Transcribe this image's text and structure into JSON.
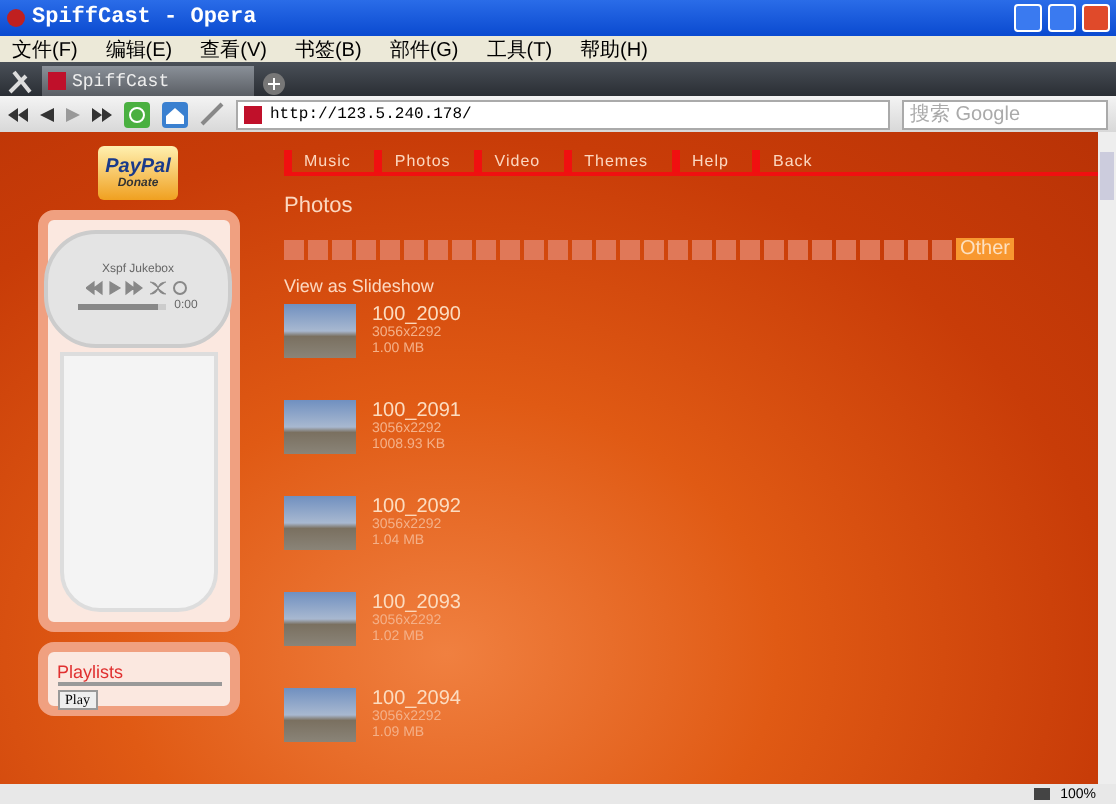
{
  "window": {
    "title": "SpiffCast - Opera"
  },
  "menu": [
    "文件(F)",
    "编辑(E)",
    "查看(V)",
    "书签(B)",
    "部件(G)",
    "工具(T)",
    "帮助(H)"
  ],
  "tabs": [
    {
      "label": "SpiffCast",
      "selected": true
    }
  ],
  "address": {
    "url": "http://123.5.240.178/"
  },
  "search": {
    "placeholder": "搜索 Google"
  },
  "sidebar": {
    "donate": {
      "brand": "PayPal",
      "label": "Donate"
    },
    "player": {
      "title": "Xspf Jukebox",
      "time": "0:00",
      "level": 0.9
    },
    "playlists": {
      "label": "Playlists",
      "button": "Play"
    }
  },
  "nav": [
    "Music",
    "Photos",
    "Video",
    "Themes",
    "Help",
    "Back"
  ],
  "heading": "Photos",
  "index_tabs": [
    {
      "selected": false
    },
    {
      "selected": false
    },
    {
      "selected": false
    },
    {
      "selected": false
    },
    {
      "selected": false
    },
    {
      "selected": false
    },
    {
      "selected": false
    },
    {
      "selected": false
    },
    {
      "selected": false
    },
    {
      "selected": false
    },
    {
      "selected": false
    },
    {
      "selected": false
    },
    {
      "selected": false
    },
    {
      "selected": false
    },
    {
      "selected": false
    },
    {
      "selected": false
    },
    {
      "selected": false
    },
    {
      "selected": false
    },
    {
      "selected": false
    },
    {
      "selected": false
    },
    {
      "selected": false
    },
    {
      "selected": false
    },
    {
      "selected": false
    },
    {
      "selected": false
    },
    {
      "selected": false
    },
    {
      "selected": false
    },
    {
      "selected": false
    },
    {
      "selected": false
    },
    {
      "label": "Other",
      "selected": true
    }
  ],
  "slideshow_link": "View as Slideshow",
  "photos": [
    {
      "name": "100_2090",
      "dimensions": "3056x2292",
      "size": "1.00 MB"
    },
    {
      "name": "100_2091",
      "dimensions": "3056x2292",
      "size": "1008.93 KB"
    },
    {
      "name": "100_2092",
      "dimensions": "3056x2292",
      "size": "1.04 MB"
    },
    {
      "name": "100_2093",
      "dimensions": "3056x2292",
      "size": "1.02 MB"
    },
    {
      "name": "100_2094",
      "dimensions": "3056x2292",
      "size": "1.09 MB"
    }
  ],
  "status_bar": {
    "zoom": "100%"
  }
}
